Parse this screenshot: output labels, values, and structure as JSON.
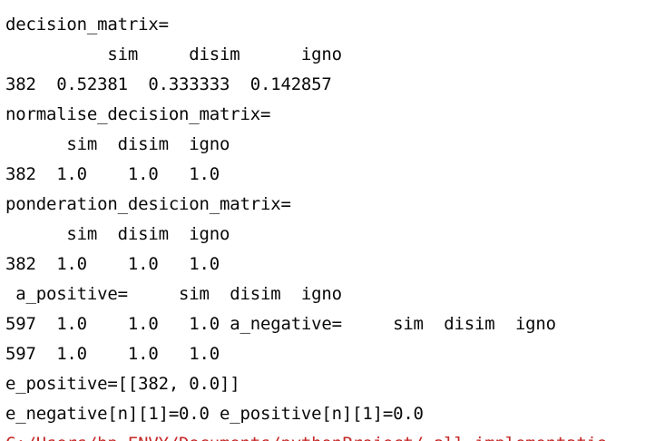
{
  "console": {
    "lines": [
      {
        "text": "decision_matrix="
      },
      {
        "text": "          sim     disim      igno"
      },
      {
        "text": "382  0.52381  0.333333  0.142857"
      },
      {
        "text": "normalise_decision_matrix="
      },
      {
        "text": "      sim  disim  igno"
      },
      {
        "text": "382  1.0    1.0   1.0"
      },
      {
        "text": "ponderation_desicion_matrix="
      },
      {
        "text": "      sim  disim  igno"
      },
      {
        "text": "382  1.0    1.0   1.0"
      },
      {
        "text": " a_positive=     sim  disim  igno"
      },
      {
        "text": "597  1.0    1.0   1.0 a_negative=     sim  disim  igno"
      },
      {
        "text": "597  1.0    1.0   1.0"
      },
      {
        "text": "e_positive=[[382, 0.0]]"
      },
      {
        "text": "e_negative[n][1]=0.0 e_positive[n][1]=0.0"
      },
      {
        "text": "C:/Users/hp ENVY/Documents/pythonProject/ all_implementatio"
      }
    ],
    "colors": {
      "text": "#080808",
      "error_text": "#c62828",
      "background": "#ffffff"
    }
  }
}
